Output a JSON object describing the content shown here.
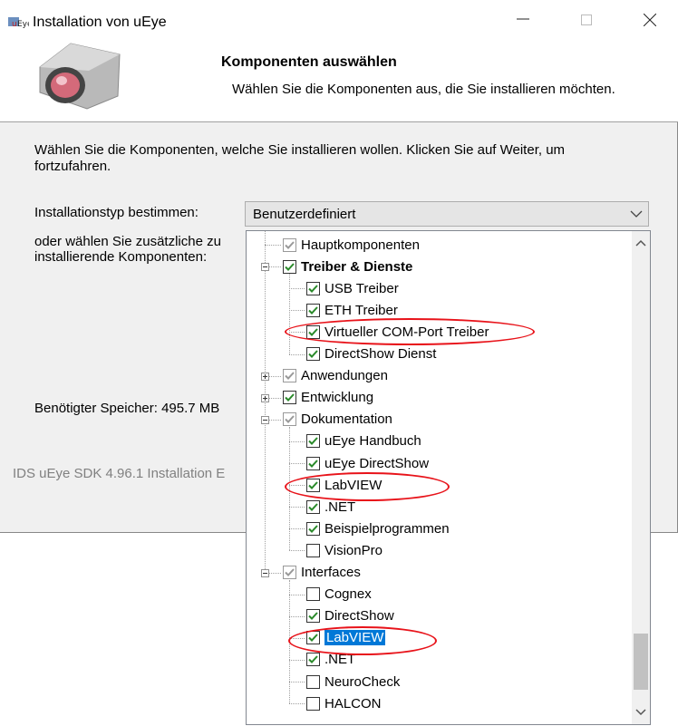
{
  "window": {
    "title": "Installation von uEye"
  },
  "header": {
    "title": "Komponenten auswählen",
    "subtitle": "Wählen Sie die Komponenten aus, die Sie installieren möchten."
  },
  "description": "Wählen Sie die Komponenten, welche Sie installieren wollen. Klicken Sie auf Weiter, um fortzufahren.",
  "install_type": {
    "label": "Installationstyp bestimmen:",
    "value": "Benutzerdefiniert"
  },
  "components_label": "oder wählen Sie zusätzliche zu installierende Komponenten:",
  "space_required": "Benötigter Speicher: 495.7 MB",
  "footer": "IDS uEye SDK 4.96.1 Installation E",
  "tree": {
    "items": [
      {
        "label": "Hauptkomponenten",
        "level": 1,
        "checked": "gray"
      },
      {
        "label": "Treiber & Dienste",
        "level": 1,
        "checked": "yes",
        "expander": "minus",
        "bold": true
      },
      {
        "label": "USB Treiber",
        "level": 2,
        "checked": "yes"
      },
      {
        "label": "ETH Treiber",
        "level": 2,
        "checked": "yes"
      },
      {
        "label": "Virtueller COM-Port Treiber",
        "level": 2,
        "checked": "yes"
      },
      {
        "label": "DirectShow Dienst",
        "level": 2,
        "checked": "yes"
      },
      {
        "label": "Anwendungen",
        "level": 1,
        "checked": "gray",
        "expander": "plus"
      },
      {
        "label": "Entwicklung",
        "level": 1,
        "checked": "yes",
        "expander": "plus"
      },
      {
        "label": "Dokumentation",
        "level": 1,
        "checked": "gray",
        "expander": "minus"
      },
      {
        "label": "uEye Handbuch",
        "level": 2,
        "checked": "yes"
      },
      {
        "label": "uEye DirectShow",
        "level": 2,
        "checked": "yes"
      },
      {
        "label": "LabVIEW",
        "level": 2,
        "checked": "yes"
      },
      {
        "label": ".NET",
        "level": 2,
        "checked": "yes"
      },
      {
        "label": "Beispielprogrammen",
        "level": 2,
        "checked": "yes"
      },
      {
        "label": "VisionPro",
        "level": 2,
        "checked": "no"
      },
      {
        "label": "Interfaces",
        "level": 1,
        "checked": "gray",
        "expander": "minus"
      },
      {
        "label": "Cognex",
        "level": 2,
        "checked": "no"
      },
      {
        "label": "DirectShow",
        "level": 2,
        "checked": "yes"
      },
      {
        "label": "LabVIEW",
        "level": 2,
        "checked": "yes",
        "selected": true
      },
      {
        "label": ".NET",
        "level": 2,
        "checked": "yes"
      },
      {
        "label": "NeuroCheck",
        "level": 2,
        "checked": "no"
      },
      {
        "label": "HALCON",
        "level": 2,
        "checked": "no"
      }
    ]
  },
  "colors": {
    "annotation": "#e8131a",
    "selection": "#0078d7",
    "check_green": "#2a8a2a"
  }
}
